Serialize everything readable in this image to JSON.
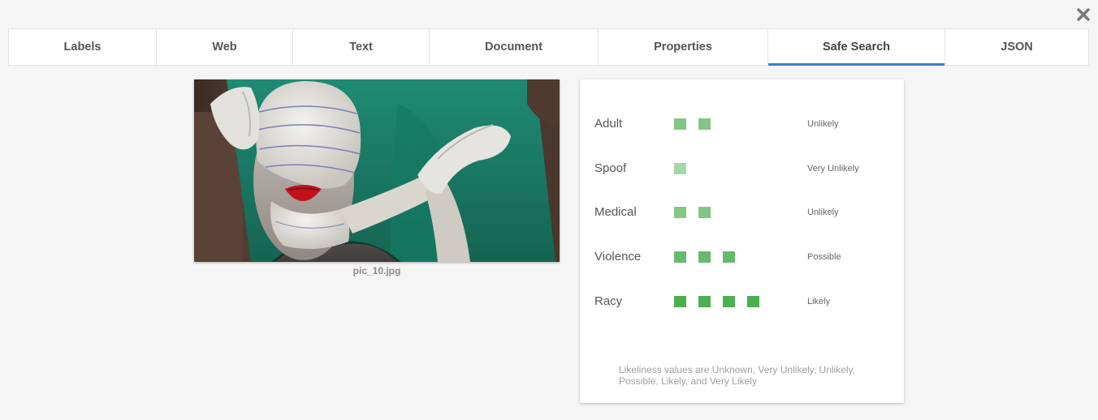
{
  "tabs": [
    {
      "label": "Labels",
      "active": false
    },
    {
      "label": "Web",
      "active": false
    },
    {
      "label": "Text",
      "active": false
    },
    {
      "label": "Document",
      "active": false
    },
    {
      "label": "Properties",
      "active": false
    },
    {
      "label": "Safe Search",
      "active": true
    },
    {
      "label": "JSON",
      "active": false
    }
  ],
  "close_icon": "close-icon",
  "image": {
    "caption": "pic_10.jpg"
  },
  "safe_search": {
    "rows": [
      {
        "label": "Adult",
        "likelihood": "Unlikely",
        "level": 2
      },
      {
        "label": "Spoof",
        "likelihood": "Very Unlikely",
        "level": 1
      },
      {
        "label": "Medical",
        "likelihood": "Unlikely",
        "level": 2
      },
      {
        "label": "Violence",
        "likelihood": "Possible",
        "level": 3
      },
      {
        "label": "Racy",
        "likelihood": "Likely",
        "level": 4
      }
    ],
    "footnote": "Likeliness values are Unknown, Very Unlikely, Unlikely, Possible, Likely, and Very Likely"
  },
  "colors": {
    "accent": "#3f7cc9",
    "level_1": "#a3d9a5",
    "level_2": "#82c784",
    "level_3": "#66bb6a",
    "level_4": "#4caf50"
  }
}
